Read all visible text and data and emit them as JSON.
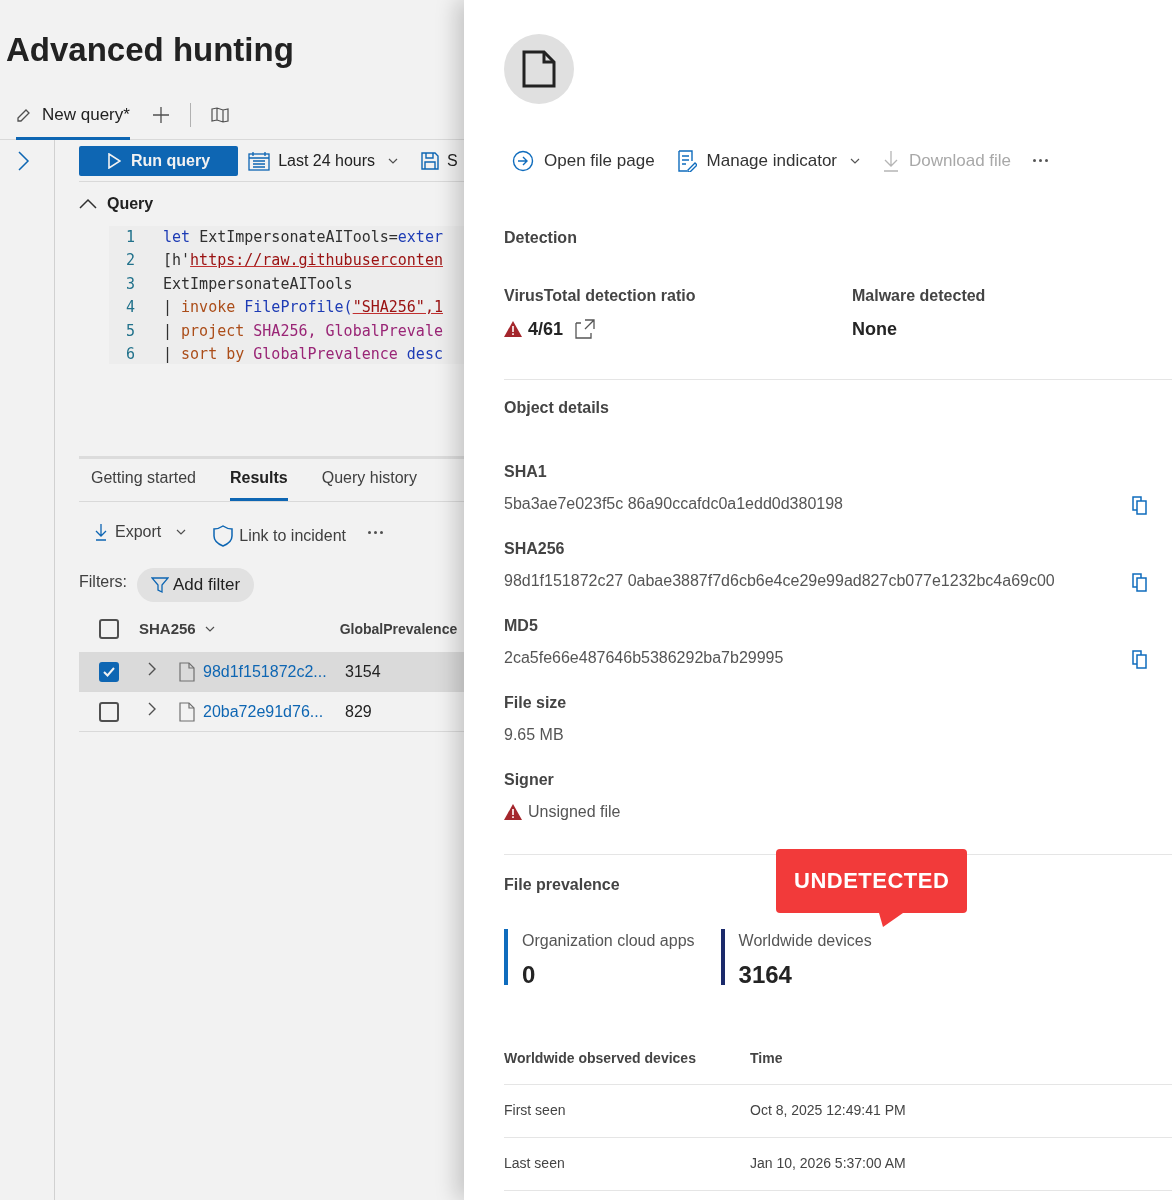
{
  "page_title": "Advanced hunting",
  "query_tabs": [
    {
      "label": "New query*",
      "selected": true
    }
  ],
  "toolbar": {
    "run": "Run query",
    "time_range": "Last 24 hours",
    "save": "S"
  },
  "query_section": {
    "title": "Query",
    "expanded": true
  },
  "code_lines": [
    {
      "number": "1",
      "tokens": [
        {
          "t": "let ",
          "kind": "keyword"
        },
        {
          "t": "ExtImpersonateAITools=",
          "kind": "plain"
        },
        {
          "t": "exter",
          "kind": "keyword"
        }
      ]
    },
    {
      "number": "2",
      "tokens": [
        {
          "t": "[h'",
          "kind": "plain"
        },
        {
          "t": "https://raw.githubuserconten",
          "kind": "string"
        }
      ]
    },
    {
      "number": "3",
      "tokens": [
        {
          "t": "ExtImpersonateAITools",
          "kind": "plain"
        }
      ]
    },
    {
      "number": "4",
      "tokens": [
        {
          "t": "| ",
          "kind": "plain"
        },
        {
          "t": "invoke ",
          "kind": "operator"
        },
        {
          "t": "FileProfile(",
          "kind": "function"
        },
        {
          "t": "\"SHA256\",1",
          "kind": "string"
        }
      ]
    },
    {
      "number": "5",
      "tokens": [
        {
          "t": "| ",
          "kind": "plain"
        },
        {
          "t": "project ",
          "kind": "operator"
        },
        {
          "t": "SHA256, GlobalPrevale",
          "kind": "column"
        }
      ]
    },
    {
      "number": "6",
      "tokens": [
        {
          "t": "| ",
          "kind": "plain"
        },
        {
          "t": "sort by ",
          "kind": "operator"
        },
        {
          "t": "GlobalPrevalence ",
          "kind": "column"
        },
        {
          "t": "desc",
          "kind": "keyword"
        }
      ]
    }
  ],
  "result_tabs": [
    {
      "label": "Getting started",
      "selected": false
    },
    {
      "label": "Results",
      "selected": true
    },
    {
      "label": "Query history",
      "selected": false
    }
  ],
  "result_actions": {
    "export": "Export",
    "link": "Link to incident"
  },
  "filters": {
    "label": "Filters:",
    "add": "Add filter"
  },
  "table": {
    "columns": [
      "SHA256",
      "GlobalPrevalence"
    ],
    "header_checked": false,
    "rows": [
      {
        "sha": "98d1f151872c2...",
        "prevalence": "3154",
        "selected": true
      },
      {
        "sha": "20ba72e91d76...",
        "prevalence": "829",
        "selected": false
      }
    ]
  },
  "flyout": {
    "actions": [
      {
        "label": "Open file page",
        "kind": "open",
        "disabled": false
      },
      {
        "label": "Manage indicator",
        "kind": "manage",
        "disabled": false
      },
      {
        "label": "Download file",
        "kind": "download",
        "disabled": true
      }
    ],
    "detection": {
      "title": "Detection",
      "ratio_label": "VirusTotal detection ratio",
      "ratio": "4/61",
      "malware_label": "Malware detected",
      "malware": "None"
    },
    "object_details": {
      "title": "Object details",
      "hashes": [
        {
          "label": "SHA1",
          "value": "5ba3ae7e023f5c 86a90ccafdc0a1edd0d380198"
        },
        {
          "label": "SHA256",
          "value": "98d1f151872c27 0abae3887f7d6cb6e4ce29e99ad827cb077e1232bc4a69c00"
        },
        {
          "label": "MD5",
          "value": "2ca5fe66e487646b5386292ba7b29995"
        }
      ],
      "file_size_label": "File size",
      "file_size": "9.65 MB",
      "signer_label": "Signer",
      "signer": "Unsigned file"
    },
    "prevalence": {
      "title": "File prevalence",
      "callout": "UNDETECTED",
      "stats": [
        {
          "label": "Organization cloud apps",
          "value": "0",
          "color": "#0f6cbd"
        },
        {
          "label": "Worldwide devices",
          "value": "3164",
          "color": "#1b2a6b"
        }
      ],
      "table": {
        "columns": [
          "Worldwide observed devices",
          "Time"
        ],
        "rows": [
          {
            "label": "First seen",
            "time": "Oct 8, 2025 12:49:41 PM"
          },
          {
            "label": "Last seen",
            "time": "Jan 10, 2026 5:37:00 AM"
          }
        ]
      }
    }
  }
}
